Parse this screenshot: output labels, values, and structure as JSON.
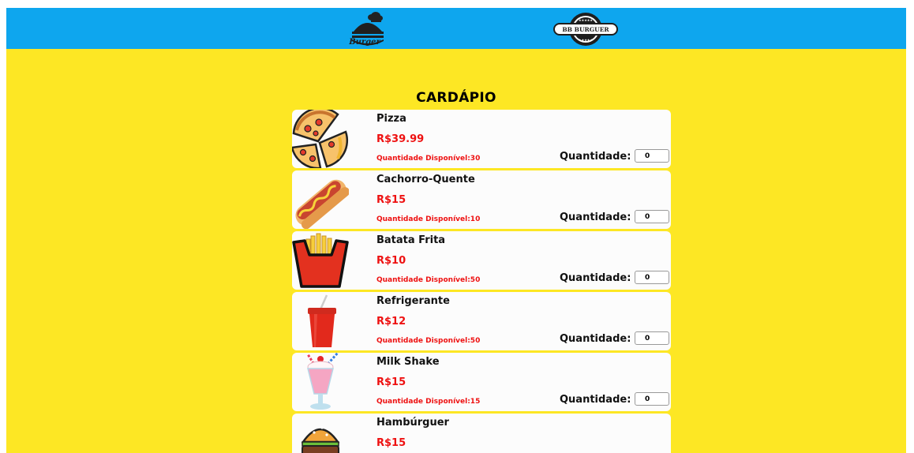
{
  "header": {
    "logo_left_text": "Burger",
    "logo_right_text": "BB BURGUER",
    "brand_color": "#0ea6ee"
  },
  "page": {
    "background_color": "#fde724",
    "title": "CARDÁPIO"
  },
  "quantity_label": "Quantidade:",
  "items": [
    {
      "name": "Pizza",
      "price": "R$39.99",
      "stock": "Quantidade Disponível:30",
      "quantity": "0",
      "icon": "pizza-icon"
    },
    {
      "name": "Cachorro-Quente",
      "price": "R$15",
      "stock": "Quantidade Disponível:10",
      "quantity": "0",
      "icon": "hotdog-icon"
    },
    {
      "name": "Batata Frita",
      "price": "R$10",
      "stock": "Quantidade Disponível:50",
      "quantity": "0",
      "icon": "fries-icon"
    },
    {
      "name": "Refrigerante",
      "price": "R$12",
      "stock": "Quantidade Disponível:50",
      "quantity": "0",
      "icon": "soda-icon"
    },
    {
      "name": "Milk Shake",
      "price": "R$15",
      "stock": "Quantidade Disponível:15",
      "quantity": "0",
      "icon": "milkshake-icon"
    },
    {
      "name": "Hambúrguer",
      "price": "R$15",
      "icon": "hamburger-icon"
    }
  ]
}
